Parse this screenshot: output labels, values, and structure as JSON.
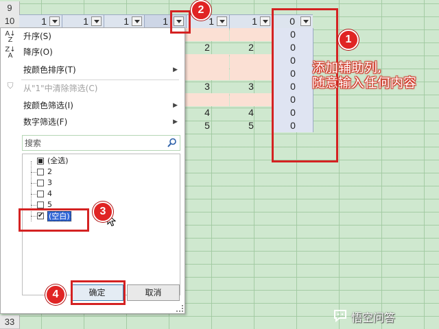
{
  "rows": {
    "r9": "9",
    "r10": "10",
    "r33": "33"
  },
  "header_values": [
    "1",
    "1",
    "1",
    "1",
    "1",
    "1"
  ],
  "data_cols": {
    "e": [
      "",
      "2",
      "",
      "",
      "3",
      "",
      "4",
      "5"
    ],
    "f": [
      "",
      "2",
      "",
      "",
      "3",
      "",
      "4",
      "5"
    ]
  },
  "helper_header": "0",
  "helper_values": [
    "0",
    "0",
    "0",
    "0",
    "0",
    "0",
    "0",
    "0"
  ],
  "menu": {
    "sort_asc": "升序(S)",
    "sort_desc": "降序(O)",
    "sort_by_color": "按颜色排序(T)",
    "clear_filter": "从\"1\"中清除筛选(C)",
    "filter_by_color": "按颜色筛选(I)",
    "number_filter": "数字筛选(F)",
    "search_placeholder": "搜索",
    "tree": [
      "(全选)",
      "2",
      "3",
      "4",
      "5",
      "(空白)"
    ],
    "ok": "确定",
    "cancel": "取消"
  },
  "annotations": {
    "badge1": "1",
    "badge2": "2",
    "badge3": "3",
    "badge4": "4",
    "note_line1": "添加辅助列,",
    "note_line2": "随意输入任何内容"
  },
  "watermark": "悟空问答",
  "colors": {
    "annotation_red": "#d42222",
    "header_blue": "#dde4ee",
    "pink": "#fbe0d4",
    "sheet_green": "#cfe8cf"
  }
}
